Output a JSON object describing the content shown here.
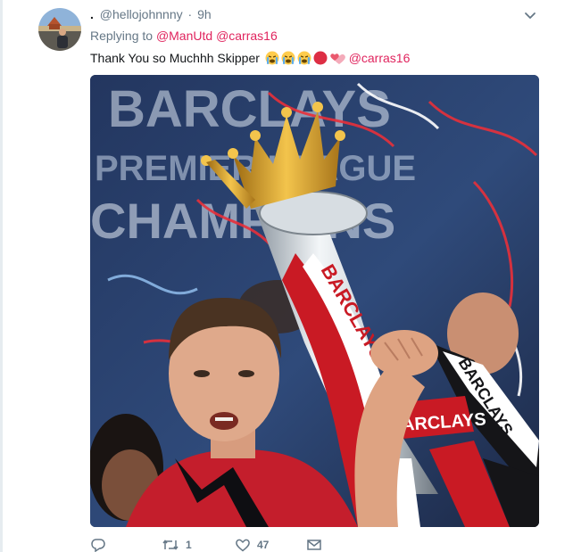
{
  "tweet": {
    "display_name": ".",
    "handle": "@hellojohnnny",
    "separator": "·",
    "time": "9h",
    "reply_prefix": "Replying to",
    "reply_to": [
      "@ManUtd",
      "@carras16"
    ],
    "text": "Thank You so Muchhh Skipper",
    "emojis": [
      "loudly-crying-face",
      "loudly-crying-face",
      "loudly-crying-face",
      "red-circle",
      "two-hearts"
    ],
    "text_mention": "@carras16"
  },
  "media": {
    "banner_lines": [
      "BARCLAYS",
      "PREMIER LEAGUE",
      "CHAMPIONS"
    ],
    "ribbon_text": "BARCLAYS"
  },
  "actions": {
    "reply": {
      "icon": "reply-icon",
      "count": ""
    },
    "retweet": {
      "icon": "retweet-icon",
      "count": "1"
    },
    "like": {
      "icon": "heart-icon",
      "count": "47"
    },
    "message": {
      "icon": "envelope-icon",
      "count": ""
    }
  },
  "colors": {
    "mention": "#e0245e",
    "meta": "#657786",
    "text": "#14171a"
  }
}
